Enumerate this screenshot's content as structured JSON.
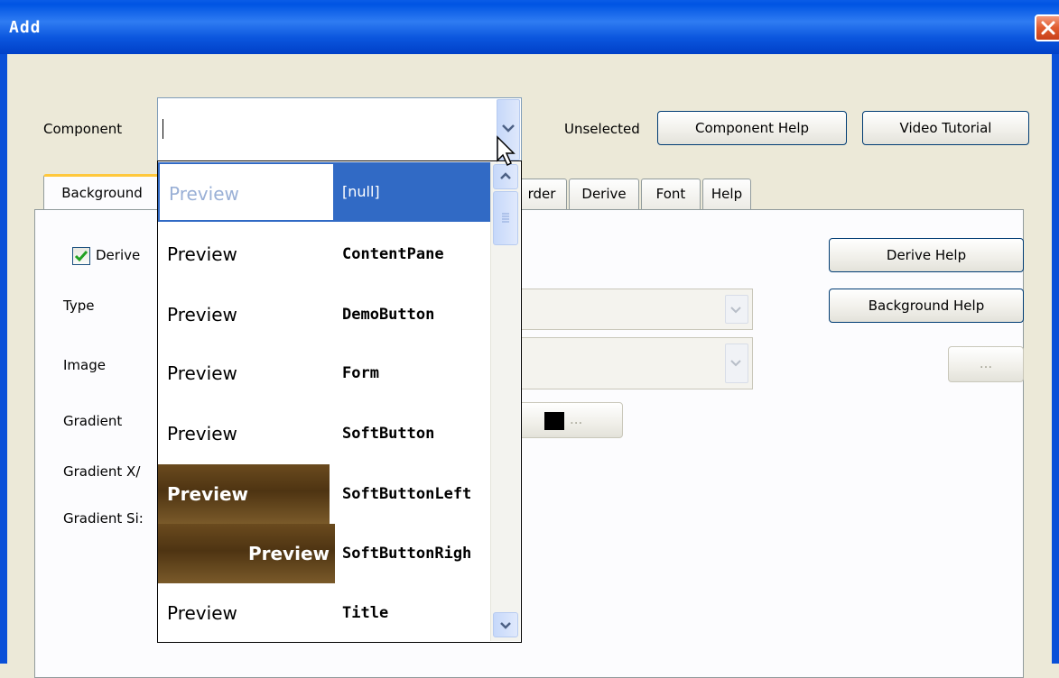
{
  "window": {
    "title": "Add"
  },
  "component_row": {
    "label": "Component",
    "input_value": "",
    "status": "Unselected",
    "component_help_label": "Component Help",
    "video_tutorial_label": "Video Tutorial"
  },
  "tabs": [
    {
      "label": "Background",
      "active": true
    },
    {
      "label": "rder"
    },
    {
      "label": "Derive"
    },
    {
      "label": "Font"
    },
    {
      "label": "Help"
    }
  ],
  "background_panel": {
    "derive_label": "Derive",
    "derive_checked": true,
    "type_label": "Type",
    "image_label": "Image",
    "gradient_label": "Gradient",
    "gradient_xy_label": "Gradient X/",
    "gradient_size_label": "Gradient Si:",
    "derive_help_label": "Derive Help",
    "background_help_label": "Background Help",
    "image_browse_label": "...",
    "gradient_color_label": "...",
    "gradient_color": "#000000"
  },
  "dropdown": {
    "items": [
      {
        "preview": "Preview",
        "name": "[null]",
        "selected": true
      },
      {
        "preview": "Preview",
        "name": "ContentPane"
      },
      {
        "preview": "Preview",
        "name": "DemoButton"
      },
      {
        "preview": "Preview",
        "name": "Form"
      },
      {
        "preview": "Preview",
        "name": "SoftButton"
      },
      {
        "preview": "Preview",
        "name": "SoftButtonLeft",
        "style": "brown"
      },
      {
        "preview": "Preview",
        "name": "SoftButtonRigh",
        "style": "brown-right"
      },
      {
        "preview": "Preview",
        "name": "Title"
      }
    ]
  },
  "colors": {
    "titlebar": "#0054e3",
    "selection": "#316ac5",
    "window_bg": "#ece9d8",
    "brown_preview": "#5a3d16"
  },
  "icons": [
    "close-icon",
    "chevron-down-icon",
    "chevron-up-icon",
    "checkmark-icon",
    "mouse-cursor-icon",
    "scroll-grip-icon"
  ]
}
